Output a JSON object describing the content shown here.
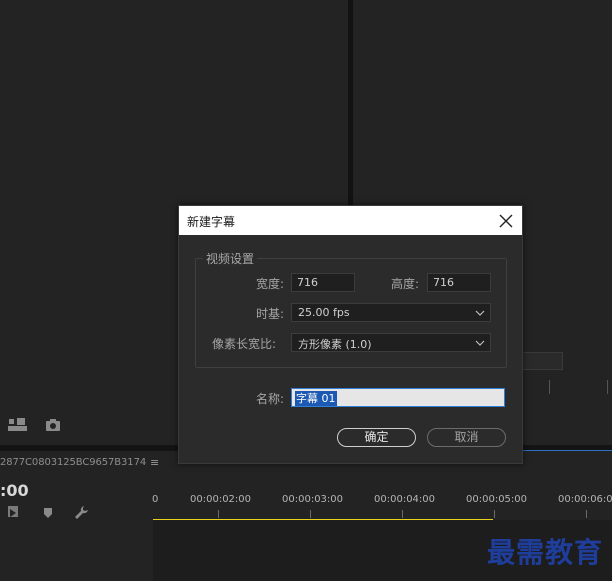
{
  "sequence": {
    "tab_label": "2877C0803125BC9657B3174",
    "menu_glyph": "≡",
    "timecode": ":00"
  },
  "ruler": {
    "labels": [
      "0",
      "00:00:02:00",
      "00:00:03:00",
      "00:00:04:00",
      "00:00:05:00",
      "00:00:06:0"
    ]
  },
  "watermark": "最需教育",
  "dialog": {
    "title": "新建字幕",
    "group_label": "视频设置",
    "width_label": "宽度:",
    "width_value": "716",
    "height_label": "高度:",
    "height_value": "716",
    "timebase_label": "时基:",
    "timebase_value": "25.00 fps",
    "pixel_aspect_label": "像素长宽比:",
    "pixel_aspect_value": "方形像素 (1.0)",
    "name_label": "名称:",
    "name_value": "字幕 01",
    "ok_label": "确定",
    "cancel_label": "取消"
  },
  "colors": {
    "accent_blue": "#2b71c8",
    "work_area_yellow": "#e8d21a",
    "watermark_blue": "#1f3e9c"
  },
  "icons": [
    "export-frame-icon",
    "camera-icon",
    "close-icon",
    "chevron-down-icon",
    "marker-icon",
    "wrench-icon",
    "snap-icon"
  ]
}
